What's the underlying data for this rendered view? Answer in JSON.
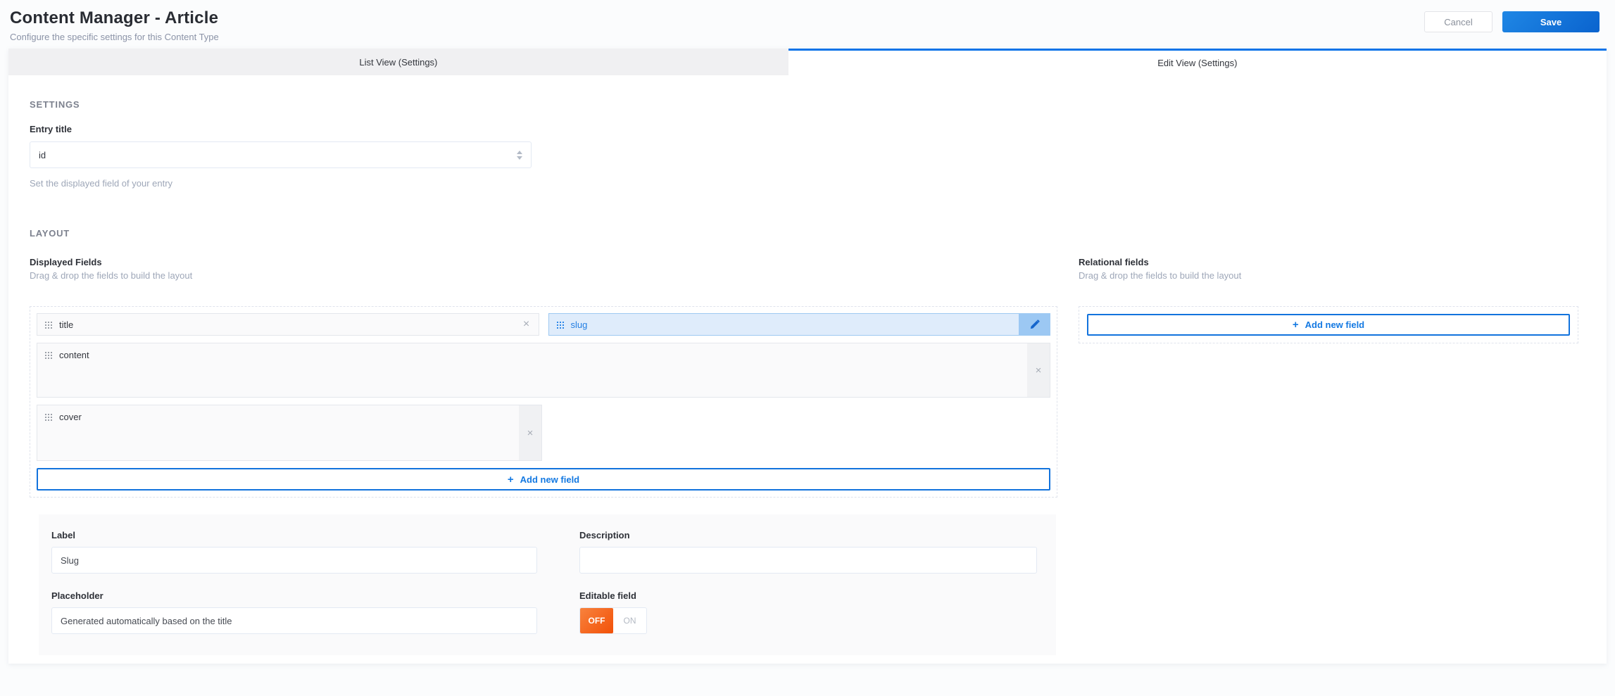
{
  "header": {
    "title": "Content Manager - Article",
    "subtitle": "Configure the specific settings for this Content Type",
    "cancel_label": "Cancel",
    "save_label": "Save"
  },
  "tabs": [
    {
      "label": "List View (Settings)",
      "active": false
    },
    {
      "label": "Edit View (Settings)",
      "active": true
    }
  ],
  "settings_section": {
    "heading": "Settings",
    "entry_title_label": "Entry title",
    "entry_title_value": "id",
    "helper": "Set the displayed field of your entry"
  },
  "layout_section": {
    "heading": "Layout",
    "displayed": {
      "title": "Displayed Fields",
      "subtitle": "Drag & drop the fields to build the layout",
      "fields": [
        {
          "name": "title",
          "selected": false
        },
        {
          "name": "slug",
          "selected": true
        },
        {
          "name": "content",
          "selected": false
        },
        {
          "name": "cover",
          "selected": false
        }
      ],
      "add_label": "Add new field"
    },
    "relational": {
      "title": "Relational fields",
      "subtitle": "Drag & drop the fields to build the layout",
      "add_label": "Add new field"
    }
  },
  "field_form": {
    "label_label": "Label",
    "label_value": "Slug",
    "description_label": "Description",
    "description_value": "",
    "placeholder_label": "Placeholder",
    "placeholder_value": "Generated automatically based on the title",
    "editable_label": "Editable field",
    "toggle_off_label": "OFF",
    "toggle_on_label": "ON",
    "editable_state": "OFF"
  },
  "icons": {
    "close": "×",
    "plus": "+"
  },
  "colors": {
    "accent_blue": "#0b74e8",
    "selected_field_bg": "#dfecfb",
    "selected_field_border": "#9ec9f2",
    "toggle_off_orange": "#f25108",
    "save_gradient_start": "#1f87e5",
    "save_gradient_end": "#0a63ce"
  }
}
